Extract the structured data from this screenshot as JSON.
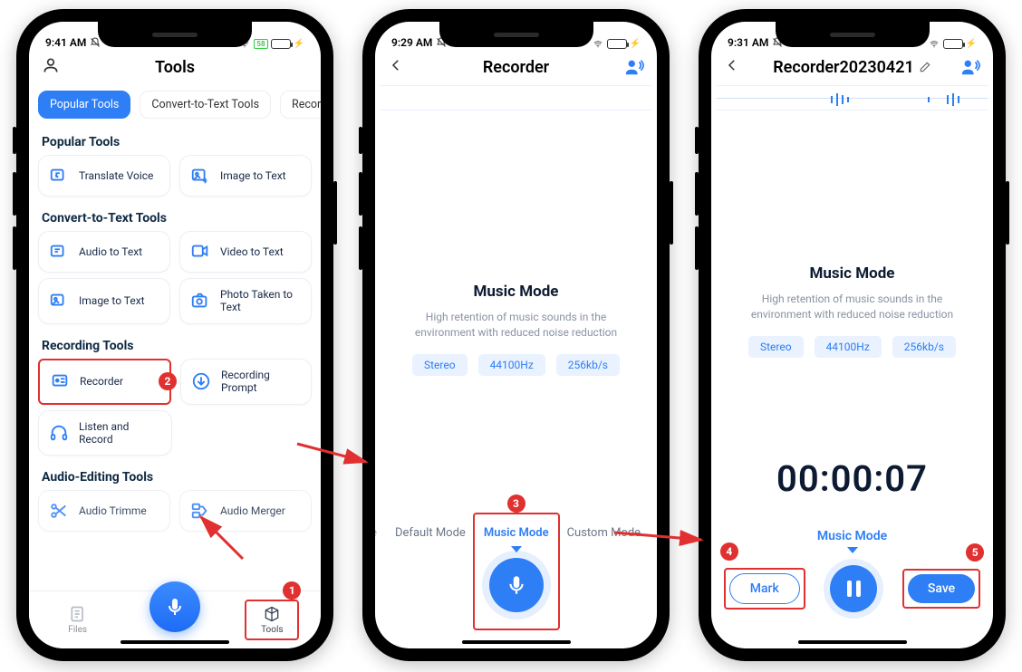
{
  "phone1": {
    "time": "9:41 AM",
    "title": "Tools",
    "tabs": {
      "popular": "Popular Tools",
      "convert": "Convert-to-Text Tools",
      "recording": "Recordin"
    },
    "section_popular": "Popular Tools",
    "tools_popular": {
      "translate": "Translate Voice",
      "imgtxt": "Image to Text"
    },
    "section_convert": "Convert-to-Text Tools",
    "tools_convert": {
      "audiotxt": "Audio to Text",
      "videotxt": "Video to Text",
      "imgtxt2": "Image to Text",
      "phototxt": "Photo Taken to Text"
    },
    "section_recording": "Recording Tools",
    "tools_recording": {
      "recorder": "Recorder",
      "prompt": "Recording Prompt",
      "listen": "Listen and Record"
    },
    "section_audio": "Audio-Editing Tools",
    "tools_audio": {
      "trimmer": "Audio Trimme",
      "merger": "Audio Merger"
    },
    "bottom": {
      "files": "Files",
      "tools": "Tools"
    }
  },
  "phone2": {
    "time": "9:29 AM",
    "title": "Recorder",
    "mode_title": "Music Mode",
    "mode_desc": "High retention of music sounds in the environment with reduced noise reduction",
    "chips": {
      "stereo": "Stereo",
      "rate": "44100Hz",
      "bitrate": "256kb/s"
    },
    "modes": {
      "default": "Default Mode",
      "music": "Music Mode",
      "custom": "Custom Mode",
      "leftclip": "le"
    }
  },
  "phone3": {
    "time": "9:31 AM",
    "title": "Recorder20230421",
    "mode_title": "Music Mode",
    "mode_desc": "High retention of music sounds in the environment with reduced noise reduction",
    "chips": {
      "stereo": "Stereo",
      "rate": "44100Hz",
      "bitrate": "256kb/s"
    },
    "timer": "00:00:07",
    "mm_label": "Music Mode",
    "mark": "Mark",
    "save": "Save"
  },
  "badges": {
    "b1": "1",
    "b2": "2",
    "b3": "3",
    "b4": "4",
    "b5": "5"
  }
}
